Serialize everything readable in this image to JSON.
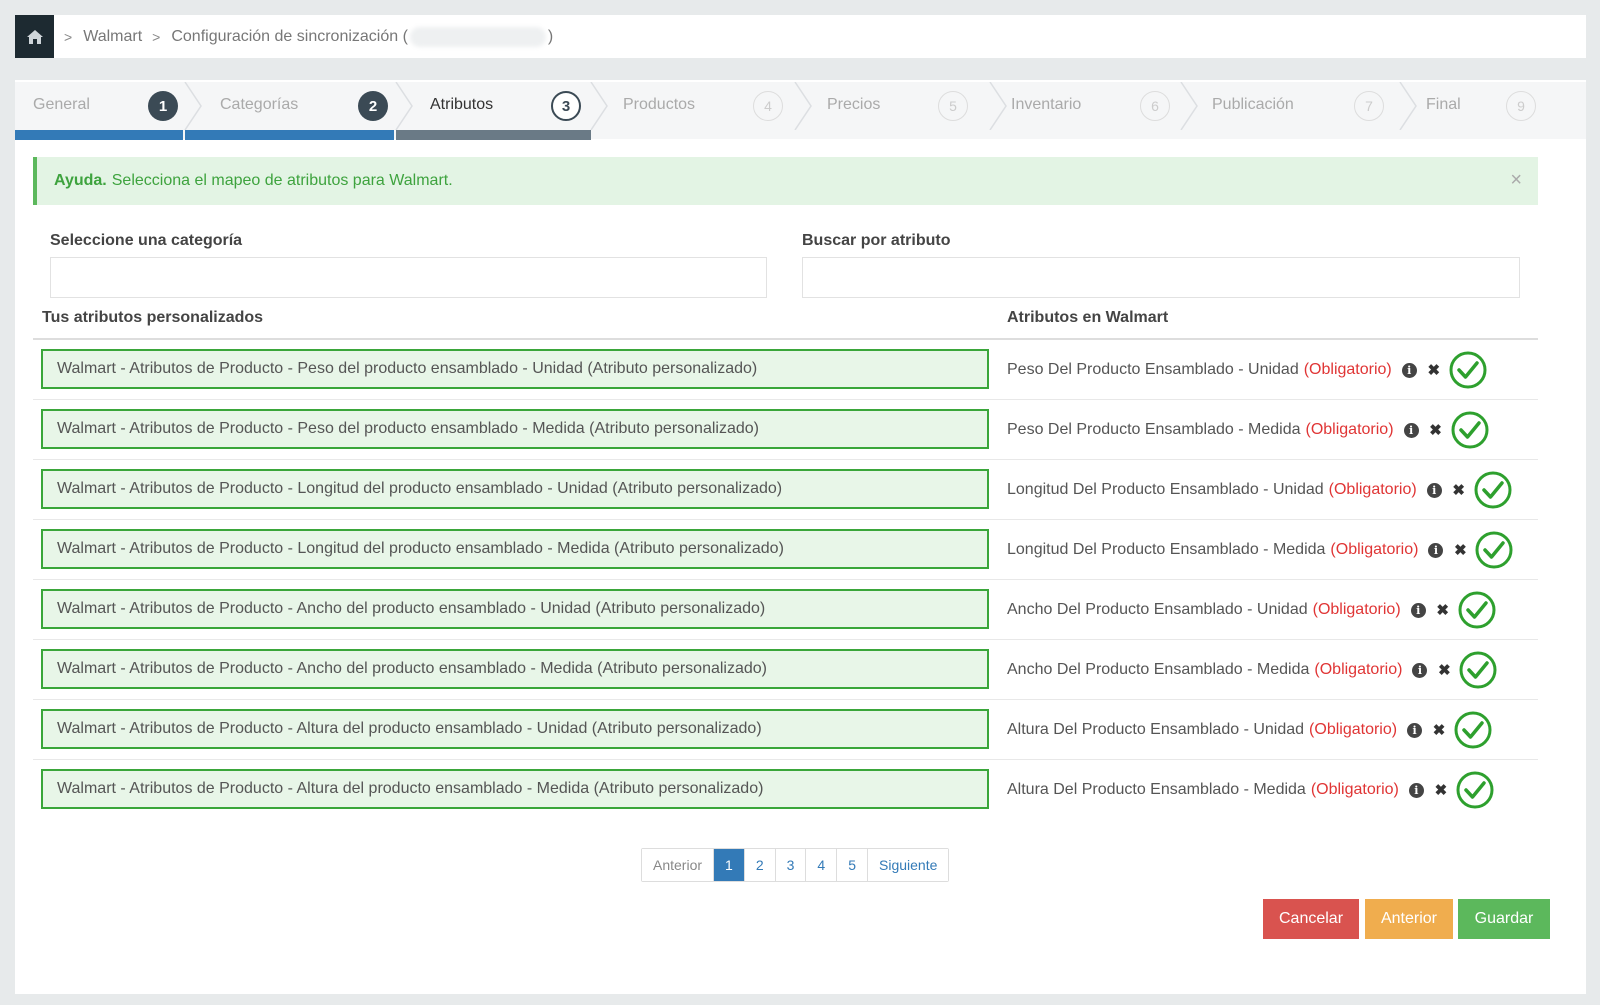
{
  "breadcrumb": {
    "items": [
      "Walmart",
      "Configuración de sincronización ("
    ],
    "suffix": ")"
  },
  "wizard": {
    "steps": [
      {
        "label": "General",
        "num": "1",
        "state": "done"
      },
      {
        "label": "Categorías",
        "num": "2",
        "state": "done"
      },
      {
        "label": "Atributos",
        "num": "3",
        "state": "active"
      },
      {
        "label": "Productos",
        "num": "4",
        "state": "todo"
      },
      {
        "label": "Precios",
        "num": "5",
        "state": "todo"
      },
      {
        "label": "Inventario",
        "num": "6",
        "state": "todo"
      },
      {
        "label": "Publicación",
        "num": "7",
        "state": "todo"
      },
      {
        "label": "Final",
        "num": "9",
        "state": "todo"
      }
    ]
  },
  "alert": {
    "title": "Ayuda.",
    "text": "Selecciona el mapeo de atributos para Walmart.",
    "close": "×"
  },
  "filters": {
    "category_label": "Seleccione una categoría",
    "category_value": "",
    "search_label": "Buscar por atributo",
    "search_value": ""
  },
  "table": {
    "left_header": "Tus atributos personalizados",
    "right_header": "Atributos en Walmart",
    "required_text": "(Obligatorio)",
    "rows": [
      {
        "custom": "Walmart - Atributos de Producto - Peso del producto ensamblado - Unidad (Atributo personalizado)",
        "walmart": "Peso Del Producto Ensamblado - Unidad"
      },
      {
        "custom": "Walmart - Atributos de Producto - Peso del producto ensamblado - Medida (Atributo personalizado)",
        "walmart": "Peso Del Producto Ensamblado - Medida"
      },
      {
        "custom": "Walmart - Atributos de Producto - Longitud del producto ensamblado - Unidad (Atributo personalizado)",
        "walmart": "Longitud Del Producto Ensamblado - Unidad"
      },
      {
        "custom": "Walmart - Atributos de Producto - Longitud del producto ensamblado - Medida (Atributo personalizado)",
        "walmart": "Longitud Del Producto Ensamblado - Medida"
      },
      {
        "custom": "Walmart - Atributos de Producto - Ancho del producto ensamblado - Unidad (Atributo personalizado)",
        "walmart": "Ancho Del Producto Ensamblado - Unidad"
      },
      {
        "custom": "Walmart - Atributos de Producto - Ancho del producto ensamblado - Medida (Atributo personalizado)",
        "walmart": "Ancho Del Producto Ensamblado - Medida"
      },
      {
        "custom": "Walmart - Atributos de Producto - Altura del producto ensamblado - Unidad (Atributo personalizado)",
        "walmart": "Altura Del Producto Ensamblado - Unidad"
      },
      {
        "custom": "Walmart - Atributos de Producto - Altura del producto ensamblado - Medida (Atributo personalizado)",
        "walmart": "Altura Del Producto Ensamblado - Medida"
      }
    ]
  },
  "pagination": {
    "prev": "Anterior",
    "pages": [
      "1",
      "2",
      "3",
      "4",
      "5"
    ],
    "current": "1",
    "next": "Siguiente"
  },
  "actions": {
    "cancel": "Cancelar",
    "previous": "Anterior",
    "save": "Guardar"
  },
  "colors": {
    "done": "#3b4a55",
    "progress_done": "#337ab7",
    "progress_active": "#6a7a86",
    "mapped_border": "#3aa63a",
    "required": "#e03535"
  }
}
